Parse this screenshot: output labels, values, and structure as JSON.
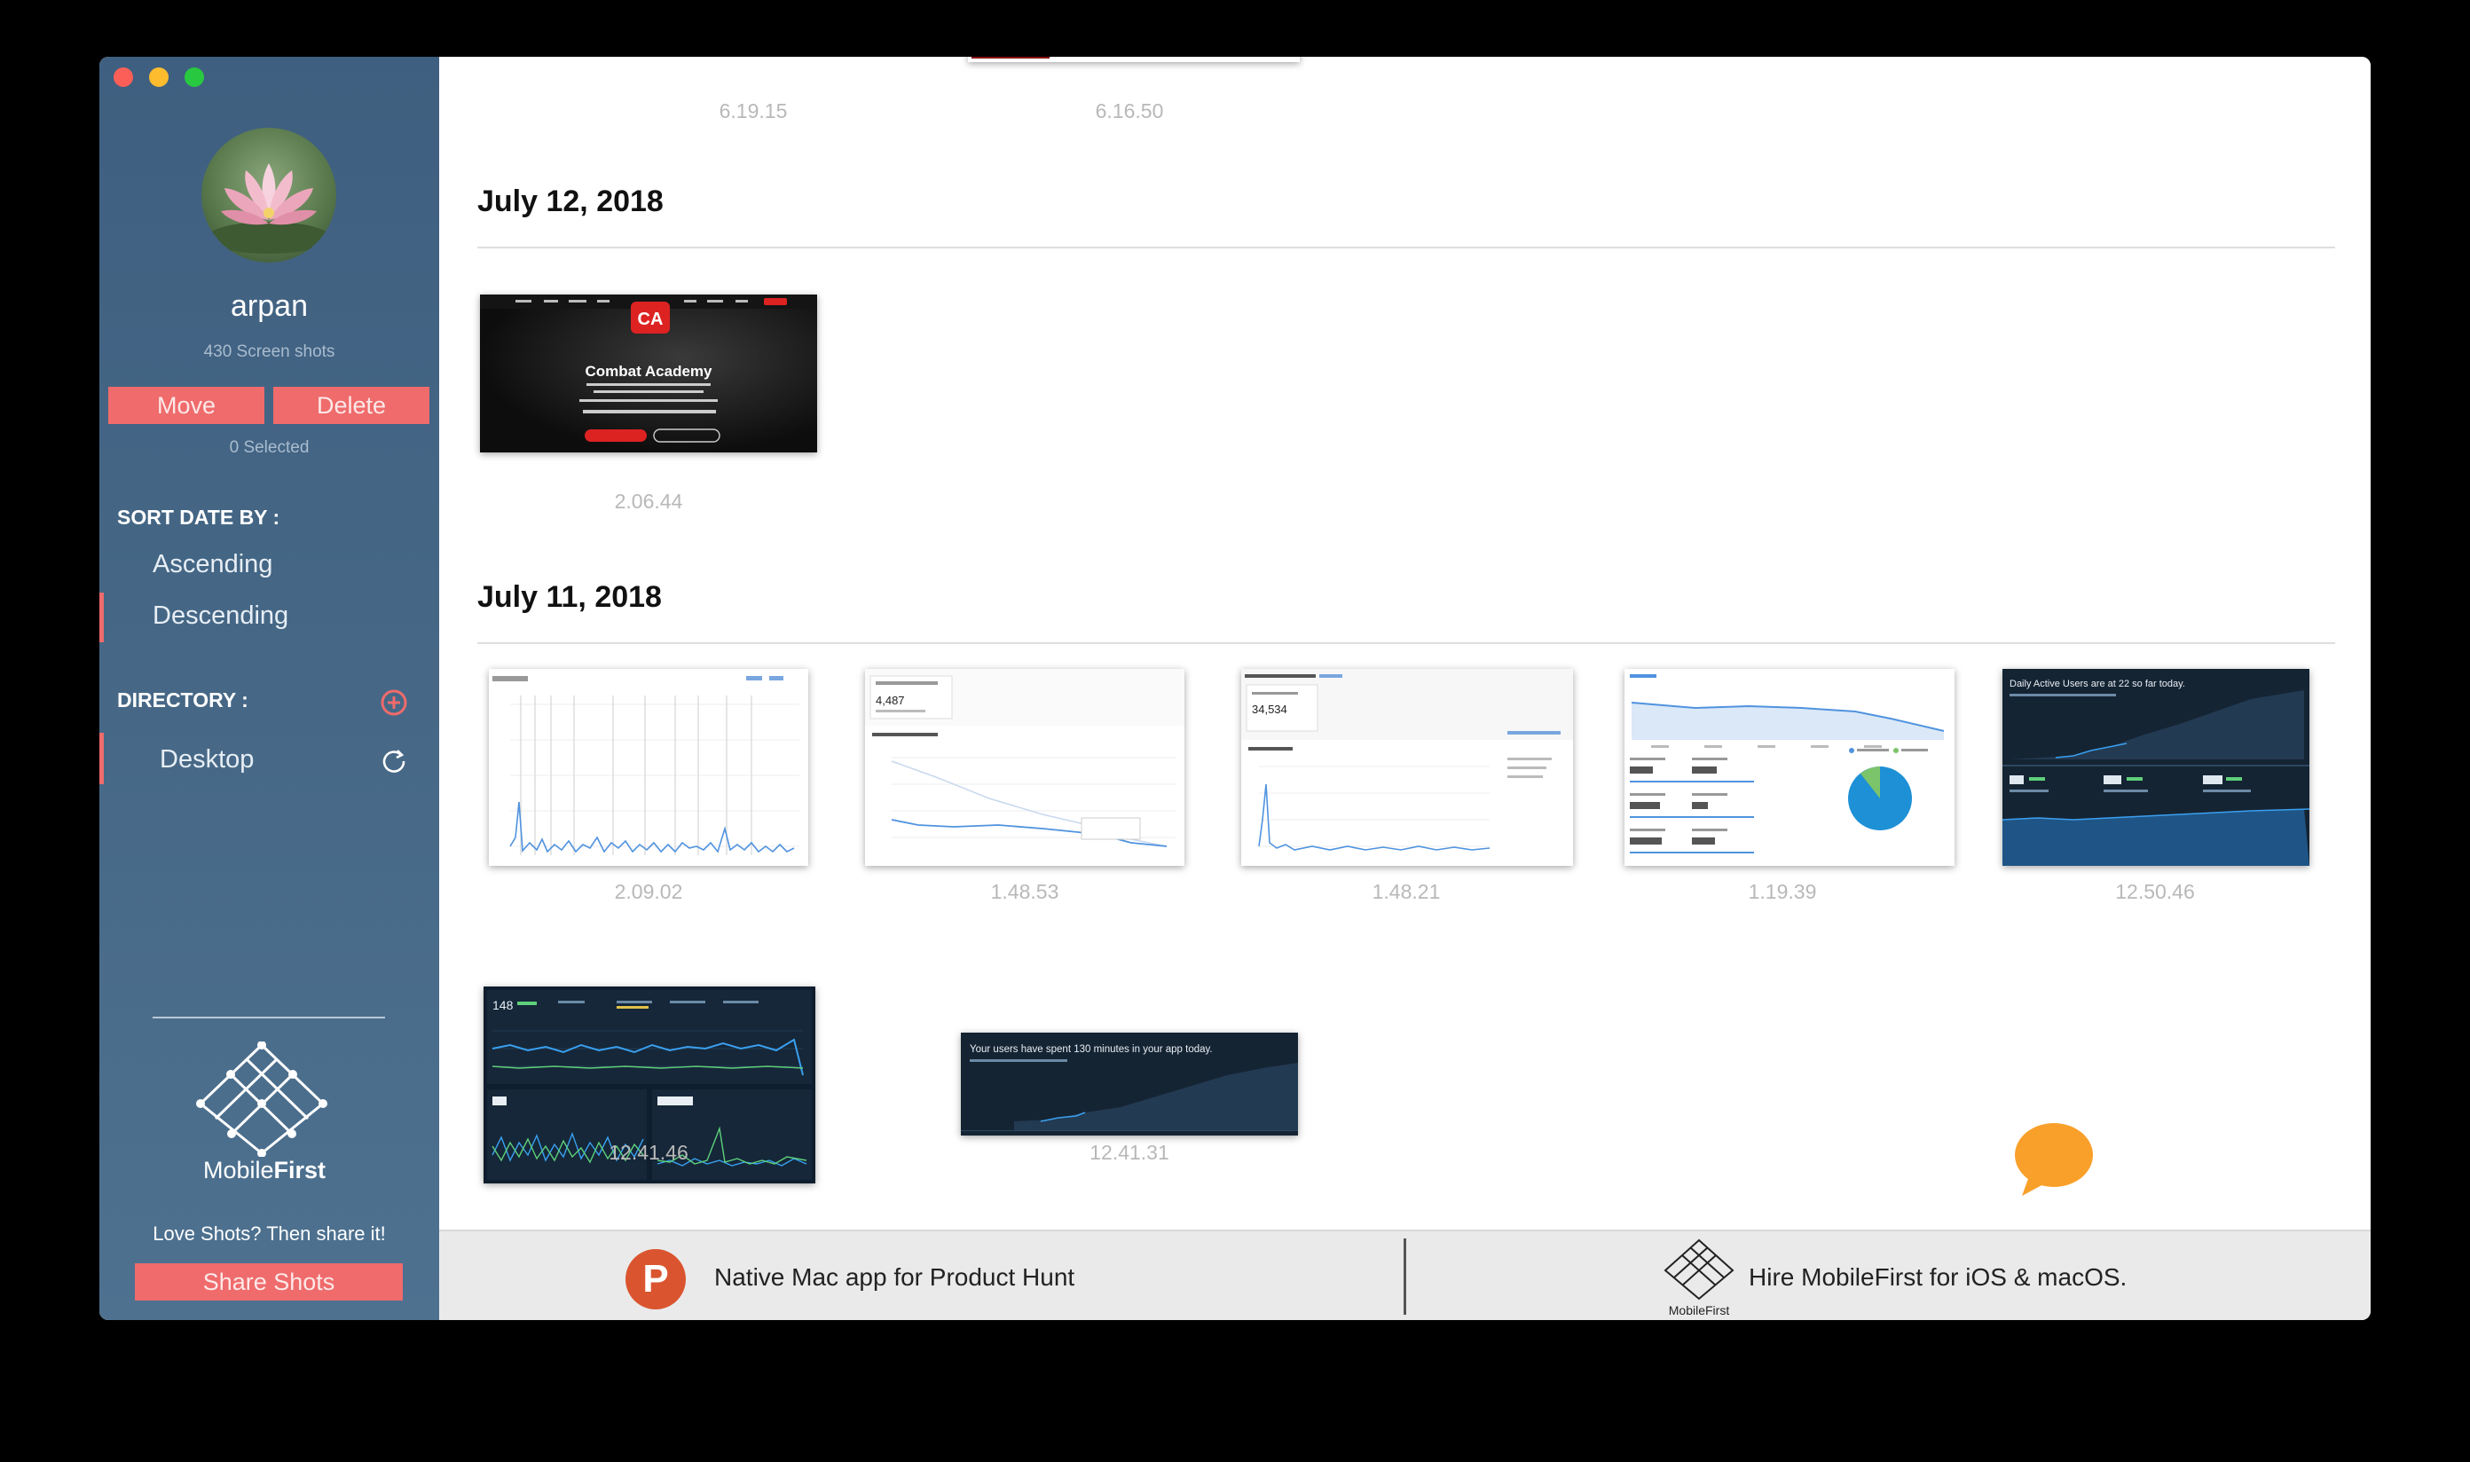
{
  "sidebar": {
    "username": "arpan",
    "shot_count": "430 Screen shots",
    "move_label": "Move",
    "delete_label": "Delete",
    "selected_text": "0 Selected",
    "sort_heading": "SORT DATE BY :",
    "sort_options": [
      "Ascending",
      "Descending"
    ],
    "sort_selected": "Descending",
    "directory_heading": "DIRECTORY :",
    "directory_item": "Desktop",
    "logo_text_1": "Mobile",
    "logo_text_2": "First",
    "love_text": "Love Shots? Then share it!",
    "share_label": "Share Shots",
    "accent": "#ef6b6c"
  },
  "main": {
    "top_times": [
      "6.19.15",
      "6.16.50"
    ],
    "groups": [
      {
        "date": "July 12, 2018",
        "shots": [
          {
            "time": "2.06.44",
            "caption": "Combat Academy"
          }
        ]
      },
      {
        "date": "July 11, 2018",
        "shots": [
          {
            "time": "2.09.02"
          },
          {
            "time": "1.48.53",
            "figure": "4,487"
          },
          {
            "time": "1.48.21",
            "figure": "34,534"
          },
          {
            "time": "1.19.39"
          },
          {
            "time": "12.50.46",
            "caption": "Daily Active Users are at 22 so far today."
          },
          {
            "time": "12.41.46",
            "figure": "148"
          },
          {
            "time": "12.41.31",
            "caption": "Your users have spent 130 minutes in your app today."
          }
        ]
      }
    ]
  },
  "footer": {
    "product_hunt_text": "Native Mac app for Product Hunt",
    "ph_letter": "P",
    "hire_text": "Hire MobileFirst for iOS & macOS.",
    "mf_small_text": "MobileFirst"
  }
}
